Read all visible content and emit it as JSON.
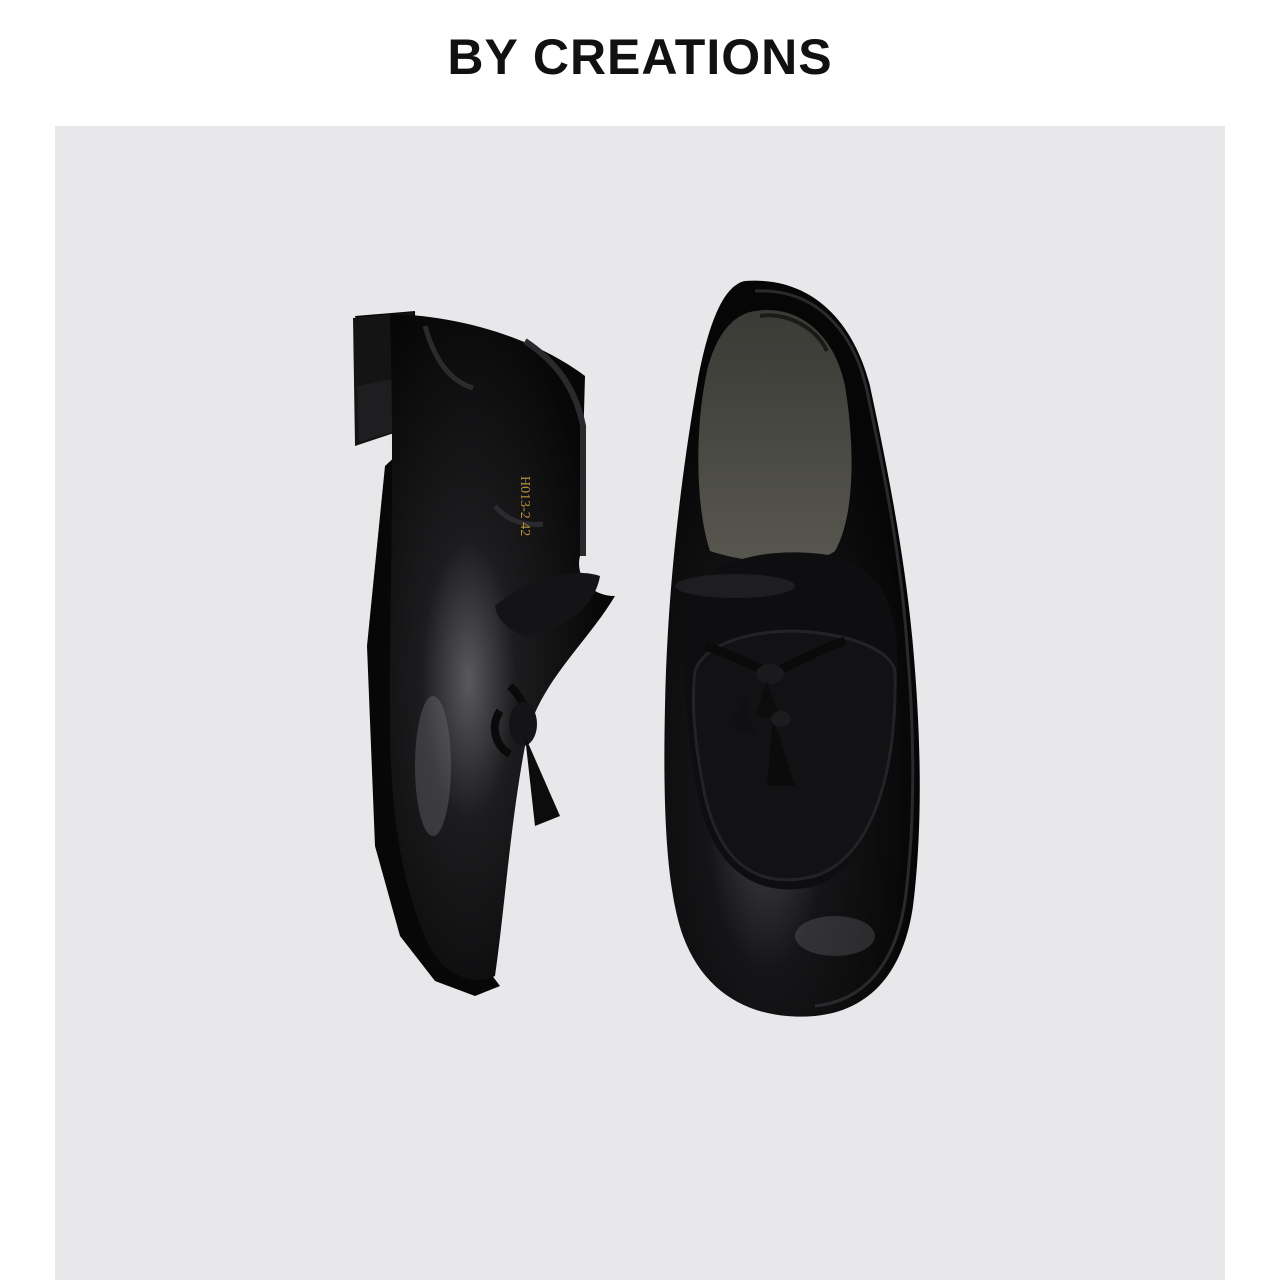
{
  "brand": {
    "name": "BY CREATIONS"
  },
  "photo": {
    "subject": "loafer-pair",
    "insole_print": "H013-2 42",
    "colors": {
      "background": "#e8e8ea",
      "leather": "#0b0b0c",
      "lining": "#4a4a46",
      "print": "#b8923a"
    }
  }
}
